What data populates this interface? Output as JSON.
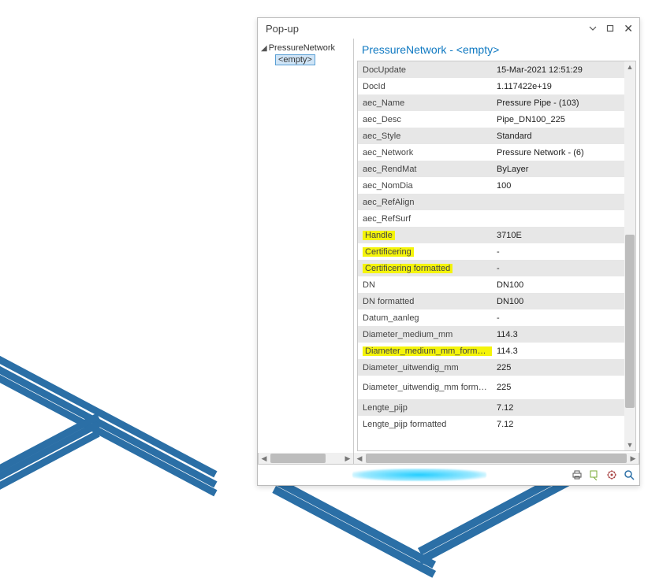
{
  "popup": {
    "title": "Pop-up",
    "tree": {
      "root_label": "PressureNetwork",
      "selected_label": "<empty>"
    },
    "content_title": "PressureNetwork - <empty>",
    "rows": [
      {
        "k": "DocUpdate",
        "v": "15-Mar-2021 12:51:29",
        "hl": false
      },
      {
        "k": "DocId",
        "v": "1.117422e+19",
        "hl": false
      },
      {
        "k": "aec_Name",
        "v": "Pressure Pipe - (103)",
        "hl": false
      },
      {
        "k": "aec_Desc",
        "v": "Pipe_DN100_225",
        "hl": false
      },
      {
        "k": "aec_Style",
        "v": "Standard",
        "hl": false
      },
      {
        "k": "aec_Network",
        "v": "Pressure Network - (6)",
        "hl": false
      },
      {
        "k": "aec_RendMat",
        "v": "ByLayer",
        "hl": false
      },
      {
        "k": "aec_NomDia",
        "v": "100",
        "hl": false
      },
      {
        "k": "aec_RefAlign",
        "v": "",
        "hl": false
      },
      {
        "k": "aec_RefSurf",
        "v": "",
        "hl": false
      },
      {
        "k": "Handle",
        "v": "3710E",
        "hl": true
      },
      {
        "k": "Certificering",
        "v": "-",
        "hl": true
      },
      {
        "k": "Certificering formatted",
        "v": "-",
        "hl": true
      },
      {
        "k": "DN",
        "v": "DN100",
        "hl": false
      },
      {
        "k": "DN formatted",
        "v": "DN100",
        "hl": false
      },
      {
        "k": "Datum_aanleg",
        "v": "-",
        "hl": false
      },
      {
        "k": "Diameter_medium_mm",
        "v": "114.3",
        "hl": false
      },
      {
        "k": "Diameter_medium_mm_formatted",
        "v": "114.3",
        "hl": true
      },
      {
        "k": "Diameter_uitwendig_mm",
        "v": "225",
        "hl": false
      },
      {
        "k": "Diameter_uitwendig_mm formatted",
        "v": "225",
        "hl": false,
        "tall": true
      },
      {
        "k": "Lengte_pijp",
        "v": "7.12",
        "hl": false
      },
      {
        "k": "Lengte_pijp formatted",
        "v": "7.12",
        "hl": false
      }
    ]
  }
}
